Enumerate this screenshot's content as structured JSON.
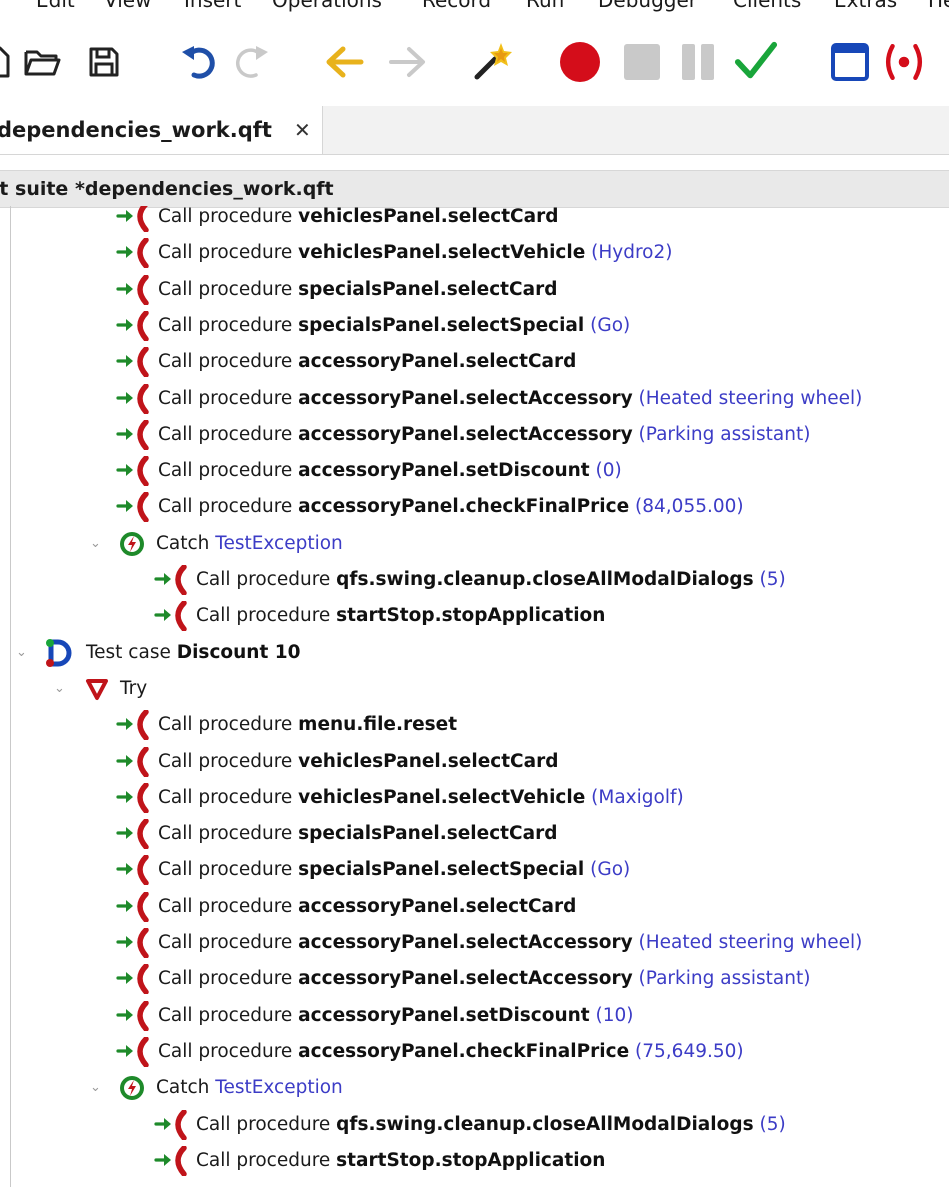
{
  "menu": [
    "Edit",
    "View",
    "Insert",
    "Operations",
    "Record",
    "Run",
    "Debugger",
    "Clients",
    "Extras",
    "He"
  ],
  "toolbar": {
    "icons": [
      "open-folder-icon",
      "save-icon",
      "undo-icon",
      "redo-icon",
      "back-icon",
      "forward-icon",
      "magic-wand-icon",
      "record-icon",
      "stop-icon",
      "pause-icon",
      "check-icon",
      "window-icon",
      "client-icon"
    ],
    "colors": {
      "undo": "#1f4fa8",
      "arrows": "#e8b21c",
      "record": "#d40d1a",
      "check": "#19a53a",
      "window": "#1747b8",
      "disabled": "#c9c9c9"
    }
  },
  "tab": {
    "title": "dependencies_work.qft",
    "close": "✕"
  },
  "suite": {
    "title": "st suite *dependencies_work.qft"
  },
  "tree": {
    "call_label": "Call procedure",
    "catch_label": "Catch",
    "test_case_label": "Test case",
    "try_label": "Try",
    "rows": [
      {
        "type": "call",
        "name": "vehiclesPanel.selectCard",
        "param": ""
      },
      {
        "type": "call",
        "name": "vehiclesPanel.selectVehicle",
        "param": "(Hydro2)"
      },
      {
        "type": "call",
        "name": "specialsPanel.selectCard",
        "param": ""
      },
      {
        "type": "call",
        "name": "specialsPanel.selectSpecial",
        "param": "(Go)"
      },
      {
        "type": "call",
        "name": "accessoryPanel.selectCard",
        "param": ""
      },
      {
        "type": "call",
        "name": "accessoryPanel.selectAccessory",
        "param": "(Heated steering wheel)"
      },
      {
        "type": "call",
        "name": "accessoryPanel.selectAccessory",
        "param": "(Parking assistant)"
      },
      {
        "type": "call",
        "name": "accessoryPanel.setDiscount",
        "param": "(0)"
      },
      {
        "type": "call",
        "name": "accessoryPanel.checkFinalPrice",
        "param": "(84,055.00)"
      },
      {
        "type": "catch",
        "name": "TestException"
      },
      {
        "type": "call",
        "name": "qfs.swing.cleanup.closeAllModalDialogs",
        "param": "(5)"
      },
      {
        "type": "call",
        "name": "startStop.stopApplication",
        "param": ""
      },
      {
        "type": "testcase",
        "name": "Discount 10"
      },
      {
        "type": "try"
      },
      {
        "type": "call",
        "name": "menu.file.reset",
        "param": ""
      },
      {
        "type": "call",
        "name": "vehiclesPanel.selectCard",
        "param": ""
      },
      {
        "type": "call",
        "name": "vehiclesPanel.selectVehicle",
        "param": "(Maxigolf)"
      },
      {
        "type": "call",
        "name": "specialsPanel.selectCard",
        "param": ""
      },
      {
        "type": "call",
        "name": "specialsPanel.selectSpecial",
        "param": "(Go)"
      },
      {
        "type": "call",
        "name": "accessoryPanel.selectCard",
        "param": ""
      },
      {
        "type": "call",
        "name": "accessoryPanel.selectAccessory",
        "param": "(Heated steering wheel)"
      },
      {
        "type": "call",
        "name": "accessoryPanel.selectAccessory",
        "param": "(Parking assistant)"
      },
      {
        "type": "call",
        "name": "accessoryPanel.setDiscount",
        "param": "(10)"
      },
      {
        "type": "call",
        "name": "accessoryPanel.checkFinalPrice",
        "param": "(75,649.50)"
      },
      {
        "type": "catch",
        "name": "TestException"
      },
      {
        "type": "call",
        "name": "qfs.swing.cleanup.closeAllModalDialogs",
        "param": "(5)"
      },
      {
        "type": "call",
        "name": "startStop.stopApplication",
        "param": ""
      }
    ]
  }
}
